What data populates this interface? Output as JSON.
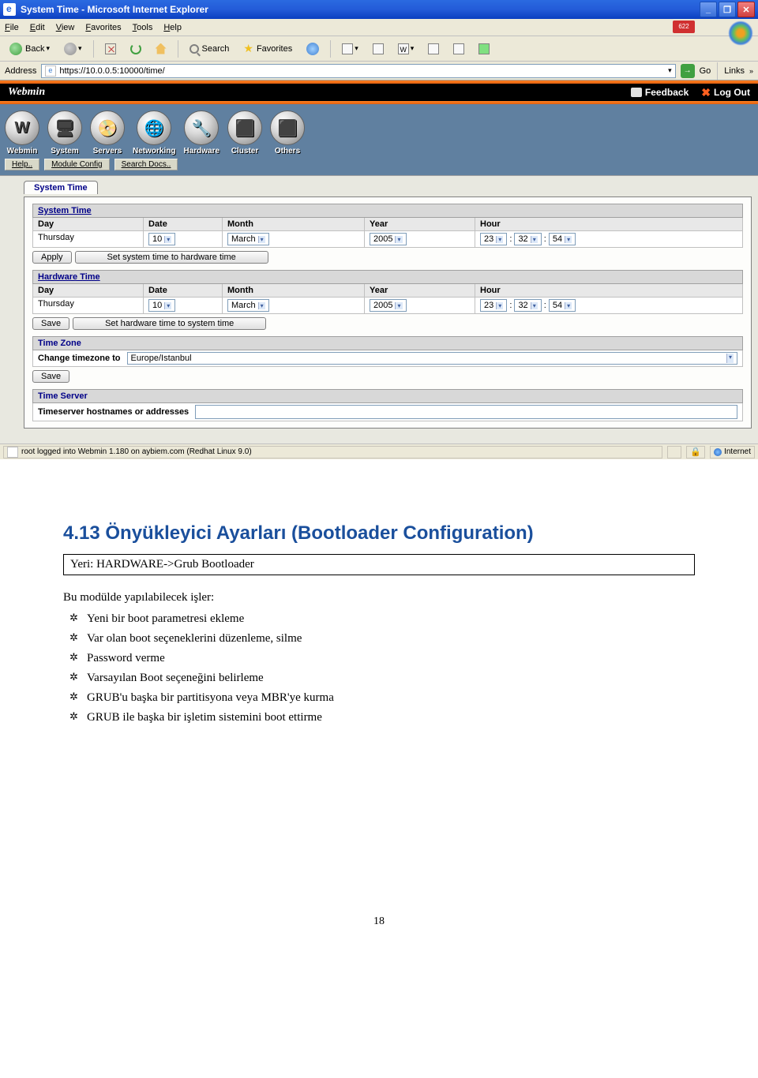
{
  "window": {
    "title": "System Time - Microsoft Internet Explorer",
    "min": "_",
    "max": "❐",
    "close": "✕"
  },
  "menu": {
    "file": "File",
    "edit": "Edit",
    "view": "View",
    "favorites": "Favorites",
    "tools": "Tools",
    "help": "Help",
    "badge": "622"
  },
  "toolbar": {
    "back": "Back",
    "search": "Search",
    "favorites": "Favorites"
  },
  "address": {
    "label": "Address",
    "url": "https://10.0.0.5:10000/time/",
    "go": "Go",
    "links": "Links",
    "chev": "»"
  },
  "webmin": {
    "title": "Webmin",
    "feedback": "Feedback",
    "logout": "Log Out",
    "nav": [
      "Webmin",
      "System",
      "Servers",
      "Networking",
      "Hardware",
      "Cluster",
      "Others"
    ],
    "nav_icons": [
      "W",
      "🖥",
      "📀",
      "🌐",
      "🔧",
      "⬛",
      "⬛"
    ],
    "sublinks": [
      "Help..",
      "Module Config",
      "Search Docs.."
    ]
  },
  "page": {
    "tab": "System Time",
    "system_time": {
      "header": "System Time",
      "cols": [
        "Day",
        "Date",
        "Month",
        "Year",
        "Hour"
      ],
      "day": "Thursday",
      "date": "10",
      "month": "March",
      "year": "2005",
      "hour1": "23",
      "hour2": "32",
      "hour3": "54",
      "apply": "Apply",
      "sync": "Set system time to hardware time"
    },
    "hardware_time": {
      "header": "Hardware Time",
      "cols": [
        "Day",
        "Date",
        "Month",
        "Year",
        "Hour"
      ],
      "day": "Thursday",
      "date": "10",
      "month": "March",
      "year": "2005",
      "hour1": "23",
      "hour2": "32",
      "hour3": "54",
      "save": "Save",
      "sync": "Set hardware time to system time"
    },
    "timezone": {
      "header": "Time Zone",
      "label": "Change timezone to",
      "value": "Europe/Istanbul",
      "save": "Save"
    },
    "timeserver": {
      "header": "Time Server",
      "label": "Timeserver hostnames or addresses"
    }
  },
  "status": {
    "text": "root logged into Webmin 1.180 on aybiem.com (Redhat Linux 9.0)",
    "zone": "Internet"
  },
  "doc": {
    "heading": "4.13 Önyükleyici Ayarları (Bootloader Configuration)",
    "yeri": "Yeri: HARDWARE->Grub Bootloader",
    "intro": "Bu modülde yapılabilecek işler:",
    "items": [
      "Yeni bir boot parametresi ekleme",
      "Var olan boot seçeneklerini düzenleme, silme",
      "Password verme",
      "Varsayılan Boot seçeneğini belirleme",
      "GRUB'u başka bir partitisyona veya MBR'ye kurma",
      "GRUB ile başka bir işletim sistemini boot ettirme"
    ],
    "page": "18"
  }
}
